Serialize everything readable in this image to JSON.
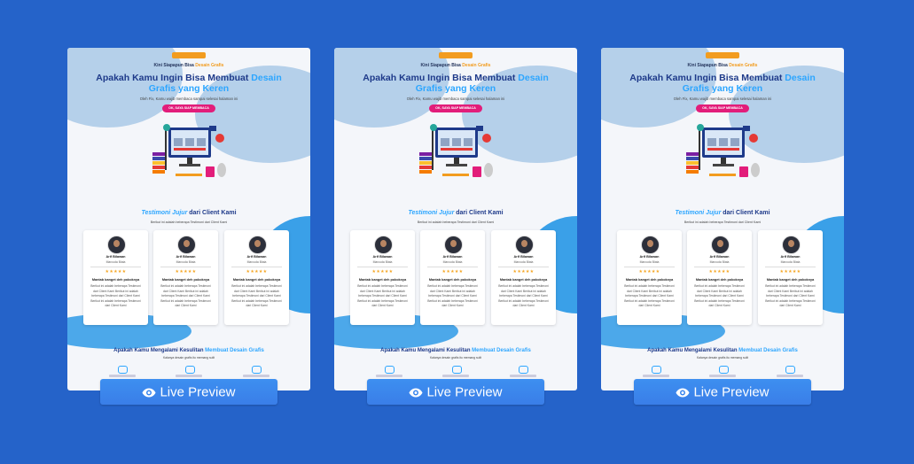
{
  "cards": [
    {
      "id": 0
    },
    {
      "id": 1
    },
    {
      "id": 2
    }
  ],
  "landing": {
    "kicker_prefix": "Kini Siapapun Bisa",
    "kicker_highlight": "Desain Grafis",
    "headline_main": "Apakah Kamu Ingin Bisa Membuat",
    "headline_highlight_1": "Desain",
    "headline_highlight_2": "Grafis yang Keren",
    "subtext": "Oleh Fix, Kamu wajib membaca sampai selesai halaman ini",
    "cta_label": "OK, SAYA SIAP MEMBACA",
    "testimonial_title_highlight": "Testimoni Jujur",
    "testimonial_title_rest": "dari Client Kami",
    "testimonial_sub": "Berikut ini adalah beberapa Testimoni dari Client Kami",
    "testimonial": {
      "name": "Arif Bilawan",
      "role": "Marcuda Blata",
      "stars": "★★★★★",
      "heading": "Mantab banget deh pokoknya",
      "body": "Berikut ini adalah beberapa Testimoni dari Client Kami Berikut ini adalah beberapa Testimoni dari Client Kami Berikut ini adalah beberapa Testimoni dari Client Kami"
    },
    "bottom_title": "Apakah Kamu Mengalami Kesulitan",
    "bottom_title_highlight": "Membuat Desain Grafis",
    "bottom_sub": "Kalanya desain grafis itu memang sulit"
  },
  "preview_label": "Live Preview",
  "icons": {
    "preview": "eye-icon"
  },
  "colors": {
    "background": "#2563c9",
    "button": "#3a86ee",
    "cta": "#e21d7a",
    "accent": "#2da6ff",
    "navy": "#1e3a8a"
  }
}
